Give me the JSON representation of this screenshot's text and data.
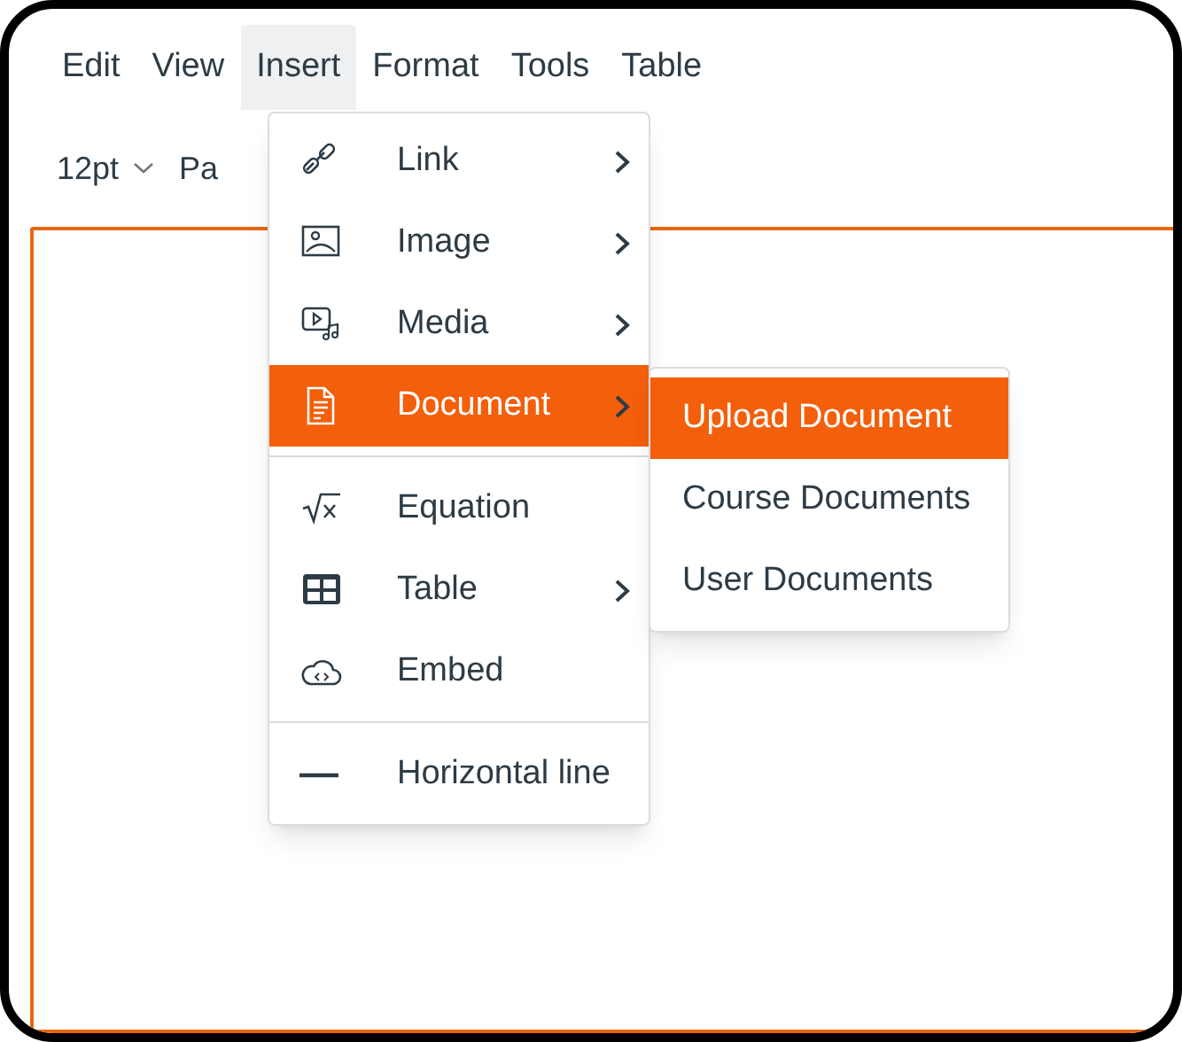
{
  "menubar": [
    {
      "label": "Edit",
      "selected": false
    },
    {
      "label": "View",
      "selected": false
    },
    {
      "label": "Insert",
      "selected": true
    },
    {
      "label": "Format",
      "selected": false
    },
    {
      "label": "Tools",
      "selected": false
    },
    {
      "label": "Table",
      "selected": false
    }
  ],
  "toolbar": {
    "font_size": "12pt",
    "paragraph_style": "Pa"
  },
  "insert_menu": {
    "sections": [
      [
        {
          "label": "Link",
          "has_submenu": true,
          "selected": false
        },
        {
          "label": "Image",
          "has_submenu": true,
          "selected": false
        },
        {
          "label": "Media",
          "has_submenu": true,
          "selected": false
        },
        {
          "label": "Document",
          "has_submenu": true,
          "selected": true
        }
      ],
      [
        {
          "label": "Equation",
          "has_submenu": false,
          "selected": false
        },
        {
          "label": "Table",
          "has_submenu": true,
          "selected": false
        },
        {
          "label": "Embed",
          "has_submenu": false,
          "selected": false
        }
      ],
      [
        {
          "label": "Horizontal line",
          "has_submenu": false,
          "selected": false
        }
      ]
    ]
  },
  "document_submenu": {
    "items": [
      {
        "label": "Upload Document",
        "selected": true
      },
      {
        "label": "Course Documents",
        "selected": false
      },
      {
        "label": "User Documents",
        "selected": false
      }
    ]
  }
}
